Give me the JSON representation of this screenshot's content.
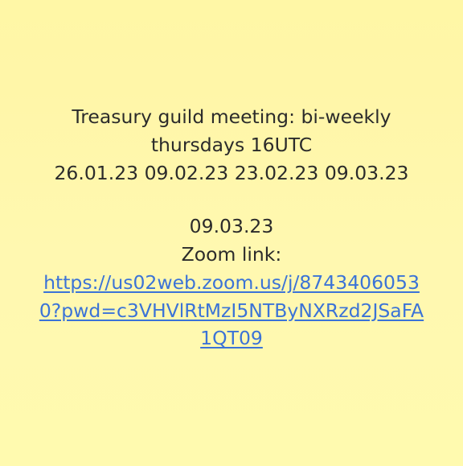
{
  "note": {
    "title_line": "Treasury guild meeting: bi-weekly",
    "schedule_line": "thursdays 16UTC",
    "dates_line": "26.01.23 09.02.23 23.02.23 09.03.23",
    "next_date": "09.03.23",
    "zoom_label": "Zoom link:",
    "zoom_url": "https://us02web.zoom.us/j/87434060530?pwd=c3VHVlRtMzI5NTByNXRzd2JSaFA1QT09"
  },
  "colors": {
    "background": "#fff8a8",
    "text": "#2b2b2b",
    "link": "#3b73d7"
  }
}
